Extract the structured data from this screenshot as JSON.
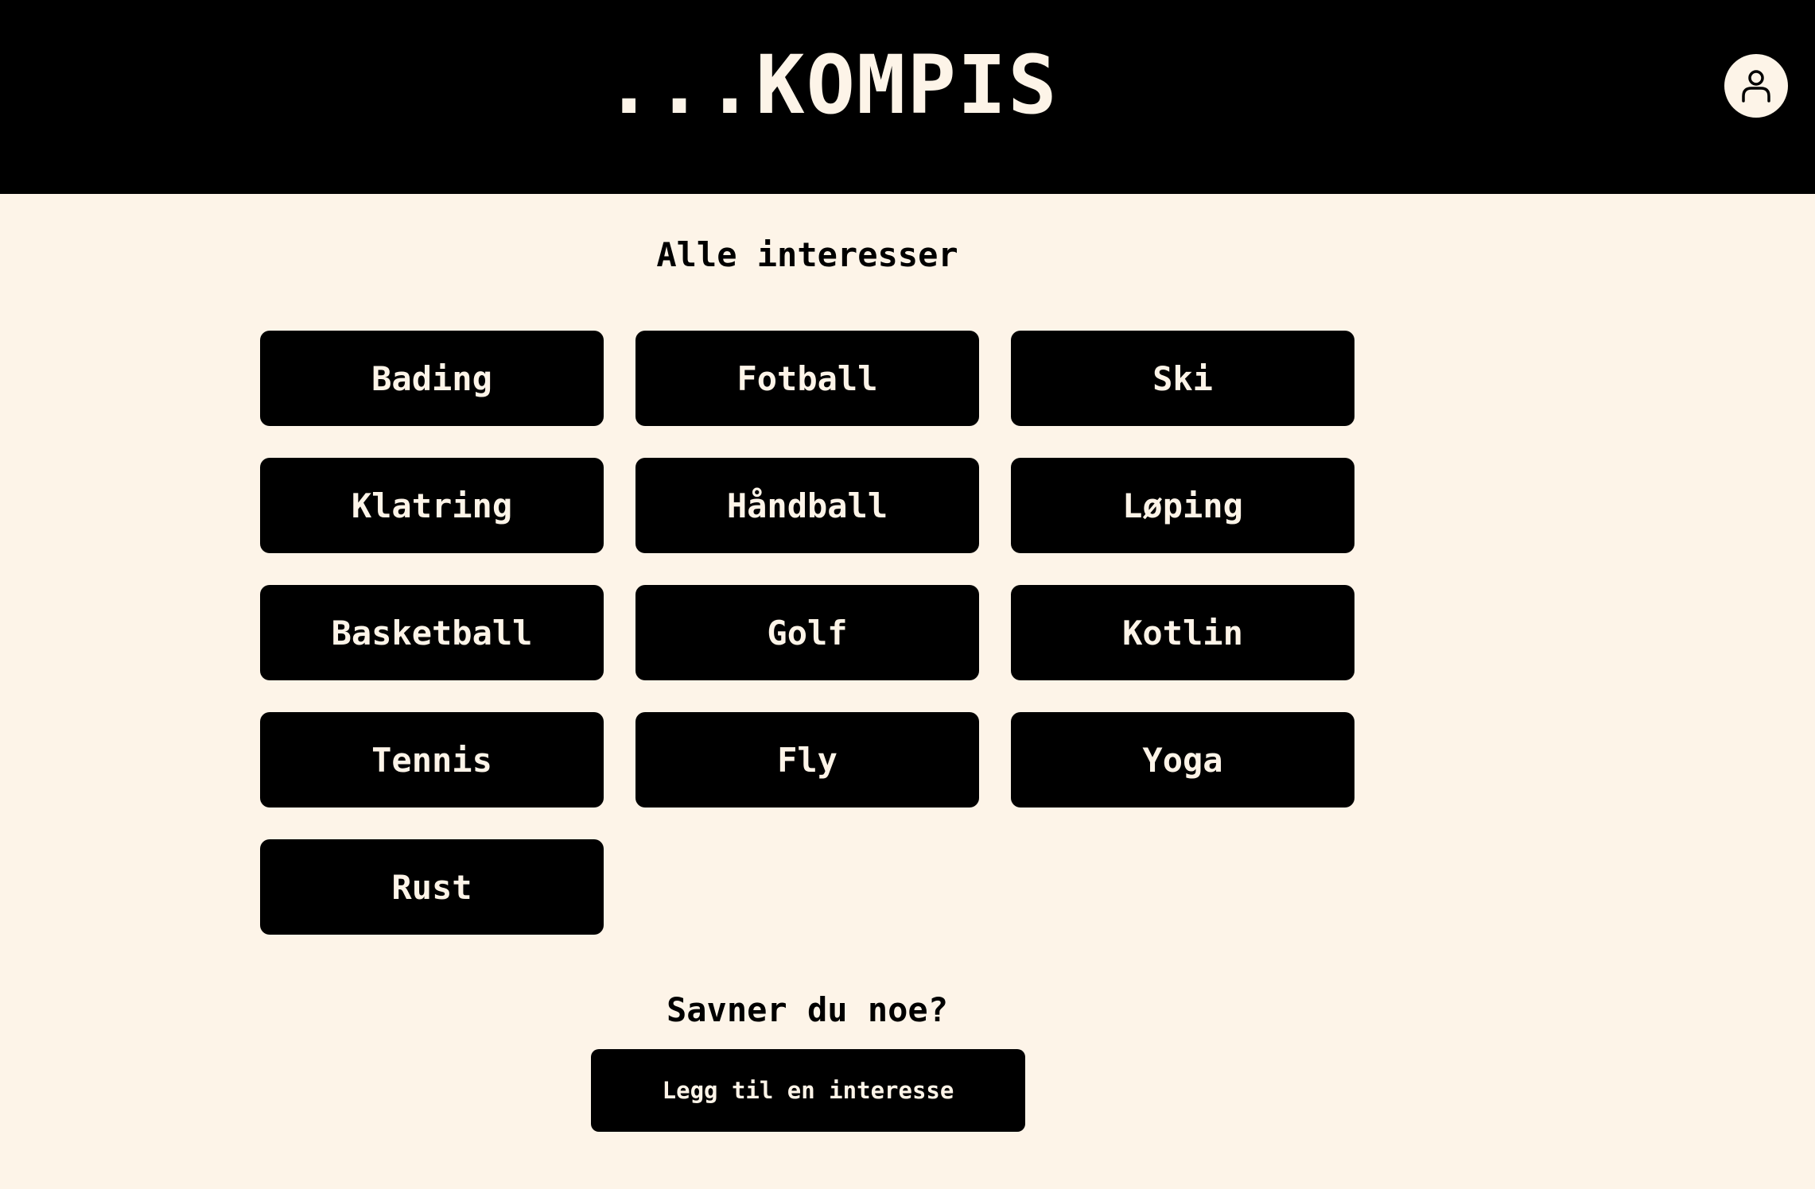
{
  "header": {
    "logo": "...KOMPIS",
    "profile_icon": "user-icon"
  },
  "main": {
    "title": "Alle interesser",
    "interests": [
      {
        "label": "Bading"
      },
      {
        "label": "Fotball"
      },
      {
        "label": "Ski"
      },
      {
        "label": "Klatring"
      },
      {
        "label": "Håndball"
      },
      {
        "label": "Løping"
      },
      {
        "label": "Basketball"
      },
      {
        "label": "Golf"
      },
      {
        "label": "Kotlin"
      },
      {
        "label": "Tennis"
      },
      {
        "label": "Fly"
      },
      {
        "label": "Yoga"
      },
      {
        "label": "Rust"
      }
    ]
  },
  "footer": {
    "prompt": "Savner du noe?",
    "add_button_label": "Legg til en interesse"
  },
  "colors": {
    "background": "#fdf4e8",
    "header": "#000000",
    "button": "#000000",
    "button_text": "#fdf4e8"
  }
}
